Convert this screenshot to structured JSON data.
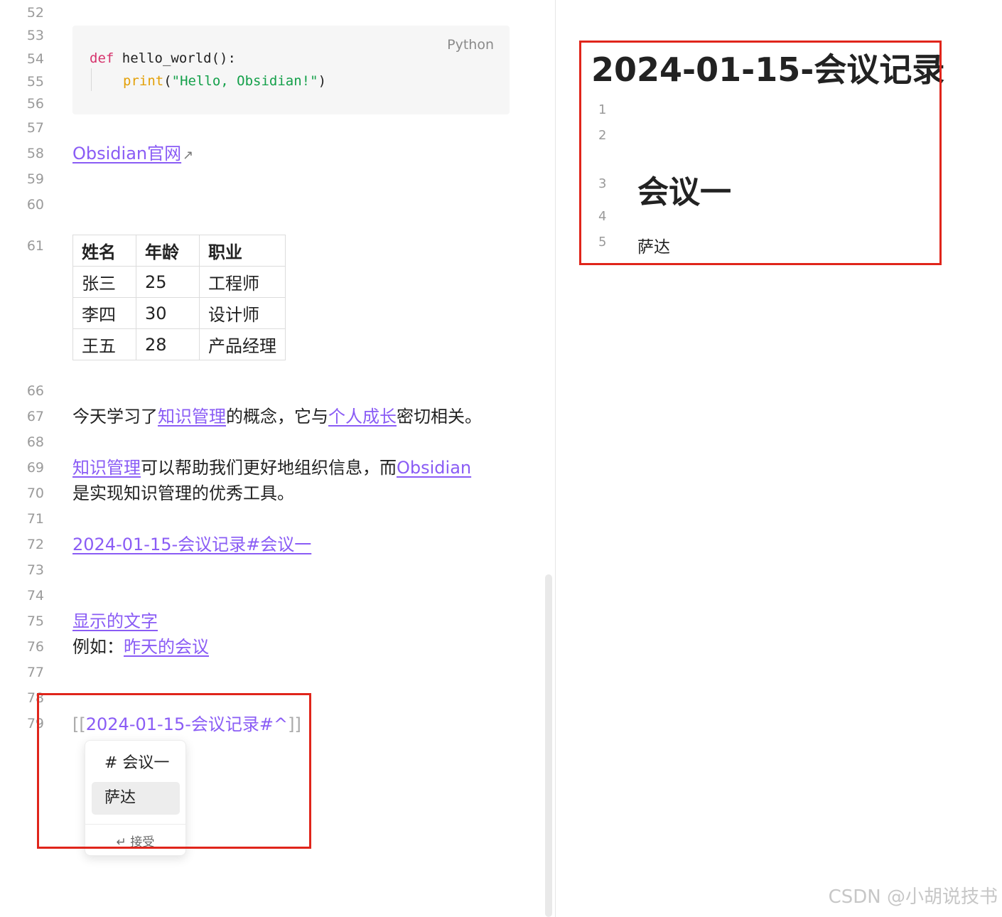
{
  "editor": {
    "line_numbers": {
      "l52": "52",
      "l53": "53",
      "l54": "54",
      "l55": "55",
      "l56": "56",
      "l57": "57",
      "l58": "58",
      "l59": "59",
      "l60": "60",
      "l61": "61",
      "l66": "66",
      "l67": "67",
      "l68": "68",
      "l69": "69",
      "l70": "70",
      "l71": "71",
      "l72": "72",
      "l73": "73",
      "l74": "74",
      "l75": "75",
      "l76": "76",
      "l77": "77",
      "l78": "78",
      "l79": "79"
    },
    "code_block": {
      "language": "Python",
      "kw_def": "def",
      "func_sig": " hello_world():",
      "print_fn": "print",
      "paren_open": "(",
      "string": "\"Hello, Obsidian!\"",
      "paren_close": ")"
    },
    "obsidian_link": "Obsidian官网",
    "external_link_icon": "↗",
    "table": {
      "headers": [
        "姓名",
        "年龄",
        "职业"
      ],
      "rows": [
        [
          "张三",
          "25",
          "工程师"
        ],
        [
          "李四",
          "30",
          "设计师"
        ],
        [
          "王五",
          "28",
          "产品经理"
        ]
      ]
    },
    "line67": {
      "pre": "今天学习了",
      "link1": "知识管理",
      "mid": "的概念，它与",
      "link2": "个人成长",
      "post": "密切相关。"
    },
    "line69": {
      "link1": "知识管理",
      "mid": "可以帮助我们更好地组织信息，而",
      "link2": "Obsidian"
    },
    "line70": "是实现知识管理的优秀工具。",
    "line72_link": "2024-01-15-会议记录#会议一",
    "line75_link": "显示的文字",
    "line76": {
      "pre": "例如：",
      "link": "昨天的会议"
    },
    "wiki_input": {
      "open": "[[",
      "target": "2024-01-15-会议记录#^",
      "close": "]]"
    },
    "autocomplete": {
      "items": [
        "# 会议一",
        "萨达"
      ],
      "selected_index": 1,
      "footer": "↵ 接受"
    }
  },
  "preview": {
    "title": "2024-01-15-会议记录",
    "line_numbers": [
      "1",
      "2",
      "3",
      "4",
      "5"
    ],
    "heading": "会议一",
    "text": "萨达"
  },
  "watermark": "CSDN @小胡说技书",
  "colors": {
    "link": "#8a5cf5",
    "annotation_box": "#e0251b"
  }
}
